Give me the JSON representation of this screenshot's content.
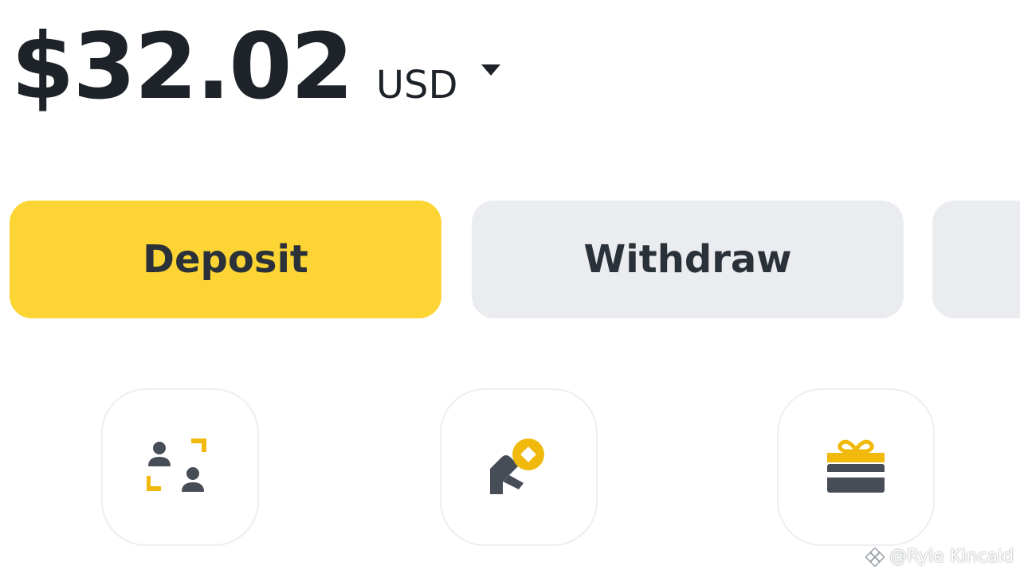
{
  "balance": {
    "amount": "$32.02",
    "currency": "USD"
  },
  "actions": {
    "deposit_label": "Deposit",
    "withdraw_label": "Withdraw"
  },
  "shortcuts": [
    {
      "icon": "p2p-trade-icon"
    },
    {
      "icon": "pay-icon"
    },
    {
      "icon": "gift-card-icon"
    }
  ],
  "watermark": {
    "text": "@Ryle Kincaid"
  },
  "colors": {
    "accent": "#fcd535",
    "secondary_button": "#eaecef",
    "text": "#1e2329",
    "icon_dark": "#474d57"
  }
}
